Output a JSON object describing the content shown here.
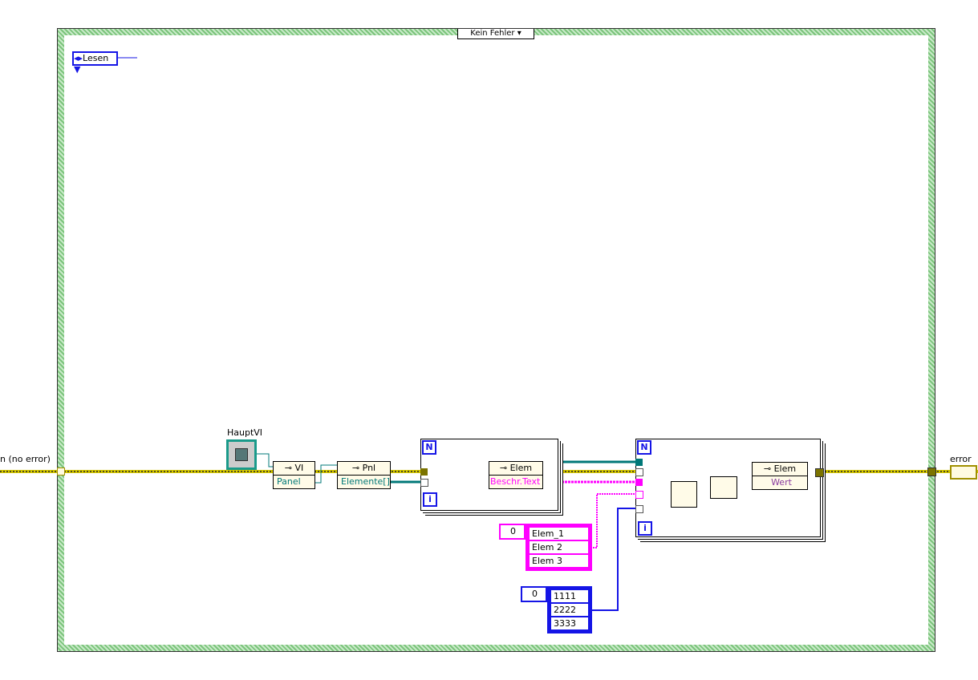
{
  "case_structure": {
    "selector": "Kein Fehler"
  },
  "enum_constant": {
    "value": "Lesen"
  },
  "error_in_label": "n (no error)",
  "error_out_label": "error IO",
  "vi_reference": {
    "label": "HauptVI"
  },
  "nodes": {
    "vi_property": {
      "class": "VI",
      "property": "Panel"
    },
    "panel_property": {
      "class": "Pnl",
      "property": "Elemente[]"
    },
    "elem_property_read": {
      "class": "Elem",
      "property": "Beschr.Text"
    },
    "elem_property_write": {
      "class": "Elem",
      "property": "Wert"
    }
  },
  "loops": {
    "count_label": "N",
    "iteration_label": "i"
  },
  "string_array": {
    "index": "0",
    "values": [
      "Elem_1",
      "Elem 2",
      "Elem 3"
    ]
  },
  "numeric_array": {
    "index": "0",
    "values": [
      "1111",
      "2222",
      "3333"
    ]
  },
  "colors": {
    "error_wire": "#d6c800",
    "reference_wire": "#007878",
    "string_wire": "#ff00ff",
    "numeric_wire": "#1515e6",
    "case_border": "#7cc47c"
  }
}
